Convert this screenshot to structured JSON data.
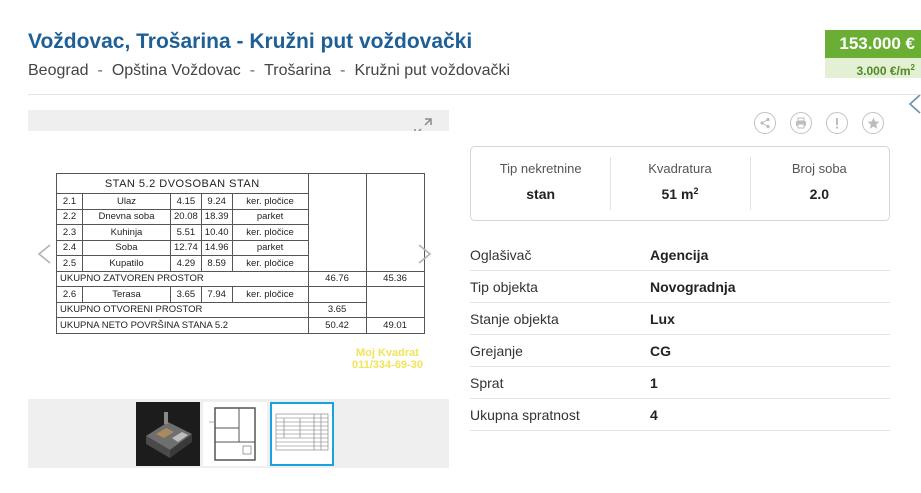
{
  "listing": {
    "title": "Voždovac, Trošarina - Kružni put voždovački",
    "breadcrumb": [
      "Beograd",
      "Opština Voždovac",
      "Trošarina",
      "Kružni put voždovački"
    ],
    "breadcrumb_separator": "-",
    "price": "153.000 €",
    "price_per_m2": "3.000 €/m",
    "price_per_m2_sup": "2"
  },
  "colors": {
    "title": "#1e5f96",
    "price_bg": "#6aaf34",
    "price_sub_bg": "#e4f0d3",
    "active_thumb": "#16a3e0"
  },
  "icons": [
    "expand-icon",
    "chevron-left-icon",
    "chevron-right-icon",
    "share-icon",
    "print-icon",
    "report-icon",
    "favorite-star-icon"
  ],
  "floorplan": {
    "header": "STAN 5.2     DVOSOBAN STAN",
    "rooms": [
      {
        "no": "2.1",
        "name": "Ulaz",
        "a": "4.15",
        "b": "9.24",
        "floor": "ker. pločice"
      },
      {
        "no": "2.2",
        "name": "Dnevna soba",
        "a": "20.08",
        "b": "18.39",
        "floor": "parket"
      },
      {
        "no": "2.3",
        "name": "Kuhinja",
        "a": "5.51",
        "b": "10.40",
        "floor": "ker. pločice"
      },
      {
        "no": "2.4",
        "name": "Soba",
        "a": "12.74",
        "b": "14.96",
        "floor": "parket"
      },
      {
        "no": "2.5",
        "name": "Kupatilo",
        "a": "4.29",
        "b": "8.59",
        "floor": "ker. pločice"
      }
    ],
    "closed_total_label": "UKUPNO ZATVOREN PROSTOR",
    "closed_total_a": "46.76",
    "closed_total_b": "45.36",
    "terrace": {
      "no": "2.6",
      "name": "Terasa",
      "a": "3.65",
      "b": "7.94",
      "floor": "ker. pločice"
    },
    "open_total_label": "UKUPNO OTVORENI PROSTOR",
    "open_total_a": "3.65",
    "net_total_label": "UKUPNA NETO POVRŠINA STANA 5.2",
    "net_total_a": "50.42",
    "net_total_b": "49.01",
    "watermark_line1": "Moj Kvadrat",
    "watermark_line2": "011/334-69-30"
  },
  "summary": {
    "type_label": "Tip nekretnine",
    "type_value": "stan",
    "area_label": "Kvadratura",
    "area_value": "51 m",
    "area_sup": "2",
    "rooms_label": "Broj soba",
    "rooms_value": "2.0"
  },
  "details": [
    {
      "label": "Oglašivač",
      "value": "Agencija"
    },
    {
      "label": "Tip objekta",
      "value": "Novogradnja"
    },
    {
      "label": "Stanje objekta",
      "value": "Lux"
    },
    {
      "label": "Grejanje",
      "value": "CG"
    },
    {
      "label": "Sprat",
      "value": "1"
    },
    {
      "label": "Ukupna spratnost",
      "value": "4"
    }
  ]
}
